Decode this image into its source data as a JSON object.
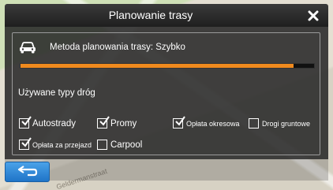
{
  "window": {
    "title": "Planowanie trasy"
  },
  "method": {
    "label": "Metoda planowania trasy: Szybko",
    "progress_percent": 93
  },
  "road_types": {
    "heading": "Używane typy dróg",
    "options": [
      {
        "label": "Autostrady",
        "checked": true
      },
      {
        "label": "Promy",
        "checked": true
      },
      {
        "label": "Opłata okresowa",
        "checked": true
      },
      {
        "label": "Drogi gruntowe",
        "checked": false
      },
      {
        "label": "Opłata za przejazd",
        "checked": true
      },
      {
        "label": "Carpool",
        "checked": false
      }
    ]
  },
  "map": {
    "street_label": "Geldermanstraat"
  },
  "icons": {
    "close": "close-icon",
    "car": "car-icon",
    "back": "back-arrow-icon"
  },
  "colors": {
    "accent": "#f08a1e",
    "back_button": "#2a86d8"
  }
}
